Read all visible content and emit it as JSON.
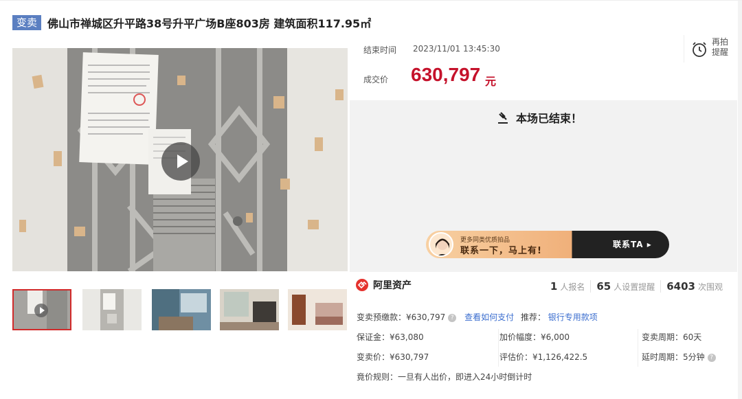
{
  "header": {
    "tag": "变卖",
    "title": "佛山市禅城区升平路38号升平广场B座803房 建筑面积117.95㎡"
  },
  "auction": {
    "end_label": "结束时间",
    "end_time": "2023/11/01 13:45:30",
    "price_label": "成交价",
    "price": "630,797",
    "price_unit": "元",
    "reminder_lines": [
      "再拍",
      "提醒"
    ],
    "ended_text": "本场已结束！"
  },
  "banner": {
    "small": "更多同类优质拍品",
    "big": "联系一下，马上有!",
    "cta": "联系TA ▸"
  },
  "brand": {
    "name": "阿里资产"
  },
  "stats": [
    {
      "num": "1",
      "label": "人报名"
    },
    {
      "num": "65",
      "label": "人设置提醒"
    },
    {
      "num": "6403",
      "label": "次围观"
    }
  ],
  "details": {
    "deposit_pay": "变卖预缴款：¥630,797",
    "how_to_pay": "查看如何支付",
    "recommend_label": "推荐：",
    "recommend_link": "银行专用款项",
    "margin": "保证金：¥63,080",
    "increment": "加价幅度：¥6,000",
    "cycle": "变卖周期：60天",
    "sale_price": "变卖价：¥630,797",
    "appraisal": "评估价：¥1,126,422.5",
    "delay": "延时周期：5分钟",
    "rule": "竟价规则：一旦有人出价，即进入24小时倒计时"
  },
  "colors": {
    "accent": "#c5122b",
    "tag": "#5b7fc1",
    "link": "#3b6ecf"
  }
}
